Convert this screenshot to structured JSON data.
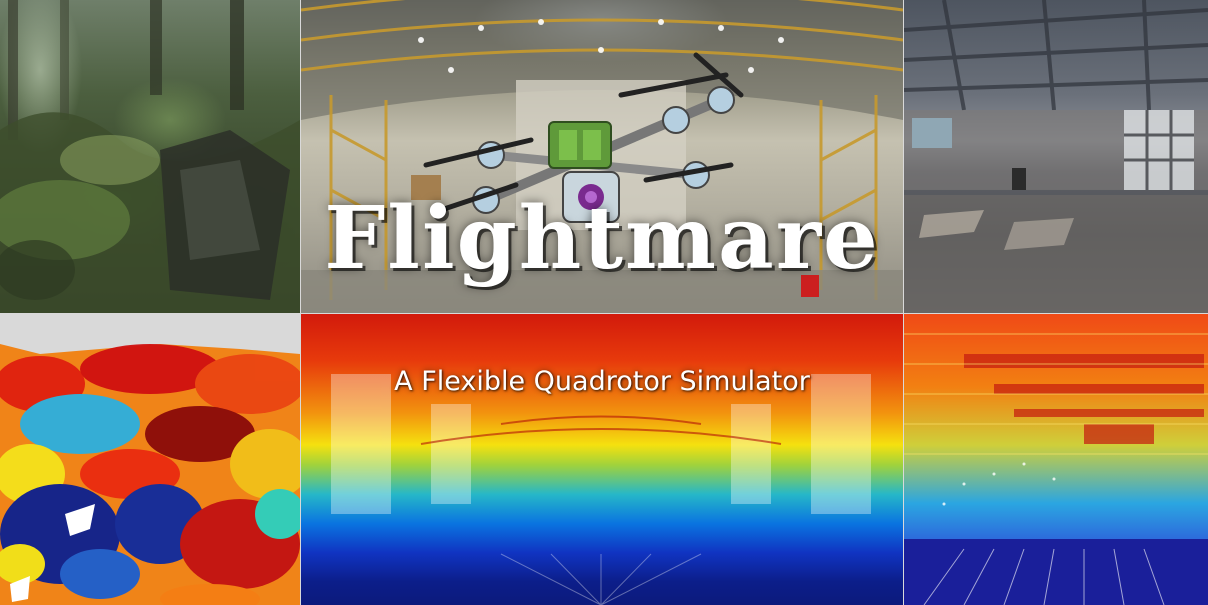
{
  "hero": {
    "title": "Flightmare",
    "subtitle": "A Flexible Quadrotor Simulator"
  },
  "tiles": [
    {
      "name": "forest-render",
      "kind": "photo"
    },
    {
      "name": "hangar-render-with-quadrotor",
      "kind": "photo"
    },
    {
      "name": "warehouse-render",
      "kind": "photo"
    },
    {
      "name": "forest-point-cloud",
      "kind": "pointcloud"
    },
    {
      "name": "hangar-depth-image",
      "kind": "depth"
    },
    {
      "name": "warehouse-point-cloud",
      "kind": "pointcloud"
    }
  ],
  "colors": {
    "background": "#d9d9d9",
    "text": "#ffffff",
    "depth_near": "#0c1a7c",
    "depth_far": "#d21a0c"
  }
}
